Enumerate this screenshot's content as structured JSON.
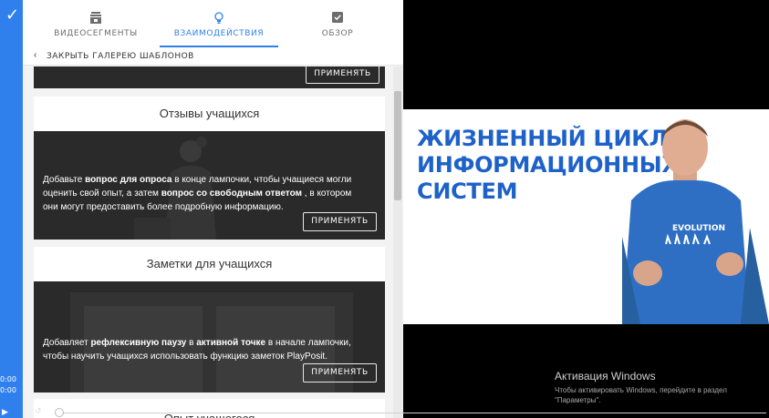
{
  "sidebar": {
    "logo_glyph": "✓",
    "time_elapsed": "0:00",
    "time_total": "0:00"
  },
  "tabs": [
    {
      "label": "ВИДЕОСЕГМЕНТЫ",
      "icon": "video-segments-icon",
      "active": false
    },
    {
      "label": "ВЗАИМОДЕЙСТВИЯ",
      "icon": "lightbulb-icon",
      "active": true
    },
    {
      "label": "ОБЗОР",
      "icon": "checkbox-icon",
      "active": false
    }
  ],
  "close_gallery": {
    "label": "ЗАКРЫТЬ ГАЛЕРЕЮ ШАБЛОНОВ"
  },
  "cards": [
    {
      "title": "",
      "button": "ПРИМЕНЯТЬ"
    },
    {
      "title": "Отзывы учащихся",
      "desc_parts": [
        "Добавьте ",
        "вопрос для опроса",
        " в конце лампочки, чтобы учащиеся могли оценить свой опыт, а затем ",
        "вопрос со свободным ответом",
        " , в котором они могут предоставить более подробную информацию."
      ],
      "button": "ПРИМЕНЯТЬ"
    },
    {
      "title": "Заметки для учащихся",
      "desc_parts": [
        "Добавляет ",
        "рефлексивную паузу",
        " в ",
        "активной точке",
        " в начале лампочки, чтобы научить учащихся использовать функцию заметок PlayPosit."
      ],
      "button": "ПРИМЕНЯТЬ"
    },
    {
      "title": "Опыт учащегося"
    }
  ],
  "video": {
    "slide_title": "ЖИЗНЕННЫЙ ЦИКЛ ИНФОРМАЦИОННЫХ СИСТЕМ",
    "shirt_text": "EVOLUTION"
  },
  "watermark": {
    "line1": "Активация Windows",
    "line2": "Чтобы активировать Windows, перейдите в раздел \"Параметры\"."
  },
  "colors": {
    "accent": "#2f80ed",
    "slide_title": "#1e62c9",
    "card_bg": "#2a2a2a"
  }
}
